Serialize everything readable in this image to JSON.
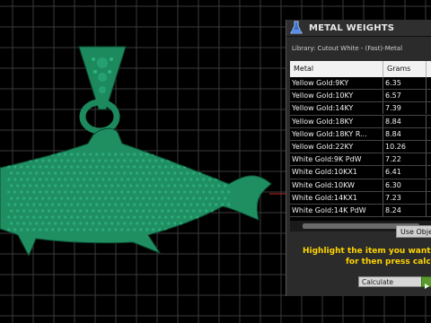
{
  "panel": {
    "title": "METAL WEIGHTS",
    "library_label": "Library: Cutout White - (Fast)-Metal",
    "columns": [
      "Metal",
      "Grams",
      ""
    ],
    "rows": [
      {
        "metal": "Yellow Gold:9KY",
        "grams": "6.35"
      },
      {
        "metal": "Yellow Gold:10KY",
        "grams": "6.57"
      },
      {
        "metal": "Yellow Gold:14KY",
        "grams": "7.39"
      },
      {
        "metal": "Yellow Gold:18KY",
        "grams": "8.84"
      },
      {
        "metal": "Yellow Gold:18KY R...",
        "grams": "8.84"
      },
      {
        "metal": "Yellow Gold:22KY",
        "grams": "10.26"
      },
      {
        "metal": "White Gold:9K PdW",
        "grams": "7.22"
      },
      {
        "metal": "White Gold:10KX1",
        "grams": "6.41"
      },
      {
        "metal": "White Gold:10KW",
        "grams": "6.30"
      },
      {
        "metal": "White Gold:14KX1",
        "grams": "7.23"
      },
      {
        "metal": "White Gold:14K PdW",
        "grams": "8.24"
      }
    ],
    "use_object_label": "Use Obje",
    "instruction_line1": "Highlight the item you want to fi",
    "instruction_line2": "for then press calcula",
    "calculate_label": "Calculate"
  },
  "colors": {
    "model": "#1f8f62",
    "grid": "#3a3a3a",
    "instruction": "#ffd400"
  }
}
